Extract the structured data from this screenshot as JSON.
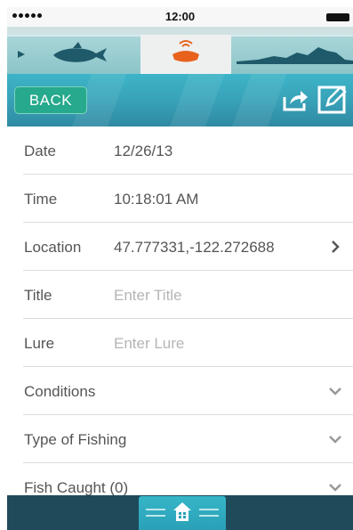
{
  "status_bar": {
    "time": "12:00",
    "signal_icon": "signal-dots-icon",
    "battery_icon": "battery-icon"
  },
  "mode_tabs": [
    {
      "name": "fish",
      "icon": "fish-icon",
      "active": false
    },
    {
      "name": "sonar",
      "icon": "sonar-device-icon",
      "active": true
    },
    {
      "name": "map",
      "icon": "terrain-map-icon",
      "active": false
    }
  ],
  "header": {
    "back_label": "BACK",
    "share_icon": "share-icon",
    "edit_icon": "edit-icon"
  },
  "rows": {
    "date": {
      "label": "Date",
      "value": "12/26/13"
    },
    "time": {
      "label": "Time",
      "value": "10:18:01 AM"
    },
    "location": {
      "label": "Location",
      "value": "47.777331,-122.272688"
    },
    "title": {
      "label": "Title",
      "placeholder": "Enter Title"
    },
    "lure": {
      "label": "Lure",
      "placeholder": "Enter Lure"
    },
    "conditions": {
      "label": "Conditions"
    },
    "type_of_fishing": {
      "label": "Type of Fishing"
    },
    "fish_caught": {
      "label": "Fish Caught (0)"
    }
  },
  "bottom_bar": {
    "home_icon": "home-icon"
  },
  "colors": {
    "accent_teal": "#38a2b8",
    "back_button": "#26a98c",
    "sonar_orange": "#e8621e",
    "bottom_bar": "#1f4a5a"
  }
}
